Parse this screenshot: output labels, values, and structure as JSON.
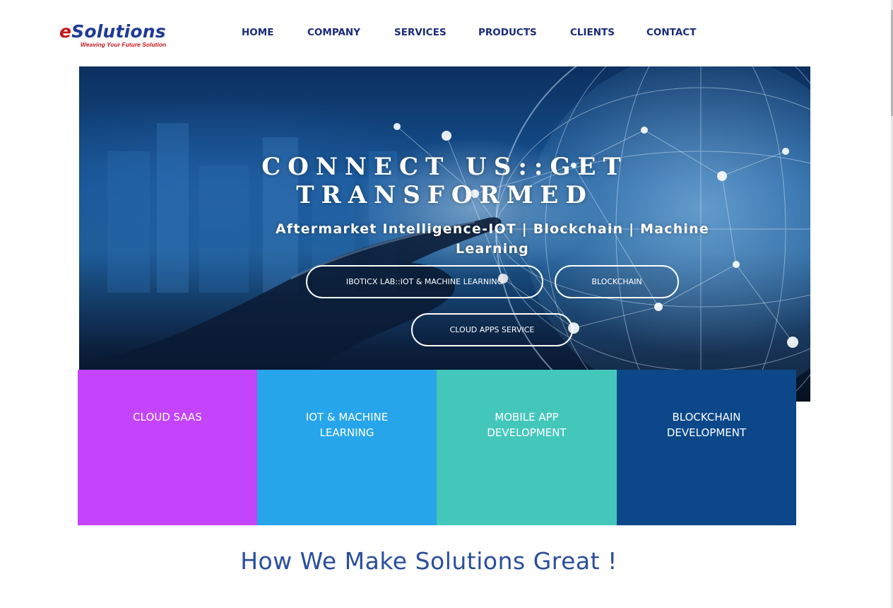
{
  "brand": {
    "logo_letter": "e",
    "logo_text": "Solutions",
    "tagline": "Weaving Your Future Solution",
    "primary_color": "#1f3a93",
    "accent_color": "#c4161c"
  },
  "nav": {
    "items": [
      {
        "label": "HOME"
      },
      {
        "label": "COMPANY"
      },
      {
        "label": "SERVICES"
      },
      {
        "label": "PRODUCTS"
      },
      {
        "label": "CLIENTS"
      },
      {
        "label": "CONTACT"
      }
    ],
    "color": "#1b2a7a"
  },
  "hero": {
    "title_line1": "CONNECT US::GET",
    "title_line2": "TRANSFORMED",
    "subtitle": "Aftermarket Intelligence-IOT | Blockchain | Machine Learning",
    "buttons": [
      {
        "label": "IBOTICX LAB::IOT & MACHINE LEARNING"
      },
      {
        "label": "BLOCKCHAIN"
      },
      {
        "label": "CLOUD APPS SERVICE"
      }
    ]
  },
  "tiles": [
    {
      "line1": "CLOUD SAAS",
      "line2": "",
      "color": "#c444fb"
    },
    {
      "line1": "IOT & MACHINE",
      "line2": "LEARNING",
      "color": "#27a5ea"
    },
    {
      "line1": "MOBILE APP",
      "line2": "DEVELOPMENT",
      "color": "#44c7bb"
    },
    {
      "line1": "BLOCKCHAIN",
      "line2": "DEVELOPMENT",
      "color": "#0b4789"
    }
  ],
  "section": {
    "title": "How We Make Solutions Great !"
  }
}
